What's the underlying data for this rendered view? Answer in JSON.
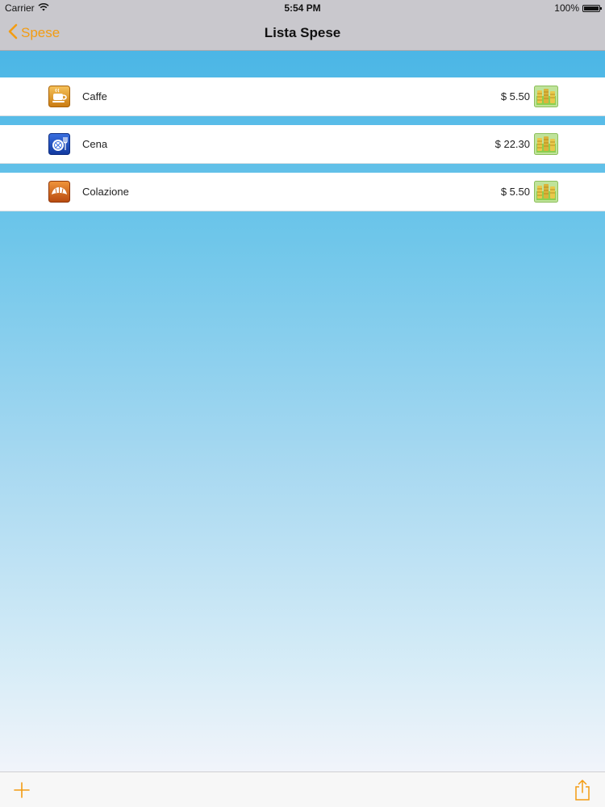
{
  "status_bar": {
    "carrier": "Carrier",
    "time": "5:54 PM",
    "battery": "100%"
  },
  "nav": {
    "back_label": "Spese",
    "title": "Lista Spese"
  },
  "expenses": [
    {
      "name": "Caffe",
      "amount": "$ 5.50",
      "icon": "coffee-cup-icon"
    },
    {
      "name": "Cena",
      "amount": "$ 22.30",
      "icon": "dinner-plate-icon"
    },
    {
      "name": "Colazione",
      "amount": "$ 5.50",
      "icon": "croissant-icon"
    }
  ],
  "colors": {
    "accent": "#f39c12",
    "bar_gray": "#c9c8cd",
    "sky_top": "#4bb6e6",
    "sky_bottom": "#f1f4fa"
  }
}
